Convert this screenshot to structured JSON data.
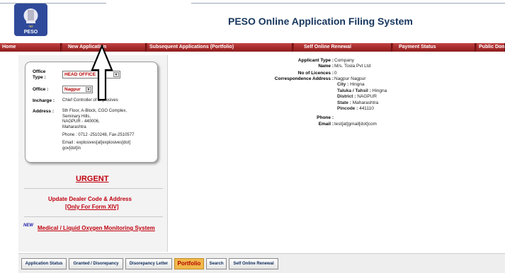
{
  "header": {
    "logo_text": "PESO",
    "title": "PESO Online Application Filing System"
  },
  "nav": {
    "items": [
      {
        "label": "Home"
      },
      {
        "label": "New Application"
      },
      {
        "label": "Subsequent Applications (Portfolio)"
      },
      {
        "label": "Self Online Renewal"
      },
      {
        "label": "Payment Status"
      },
      {
        "label": "Public Dom"
      }
    ]
  },
  "office_card": {
    "office_type_label": "Office Type :",
    "office_type_value": "HEAD OFFICE",
    "office_label": "Office :",
    "office_value": "Nagpur",
    "incharge_label": "Incharge :",
    "incharge_value": "Chief Controller of Explosives",
    "address_label": "Address :",
    "address_lines": [
      "5th Floor, A-Block, CGO Complex,",
      "Seminary Hills,",
      "NAGPUR - 440006,",
      "Maharashtra",
      "Phone : 0712 -2510248, Fax-2510577",
      "Email : explosives[at]explosives[dot]",
      "gov[dot]in"
    ]
  },
  "urgent": {
    "label": "URGENT",
    "dealer_line1": "Update Dealer Code & Address",
    "dealer_line2": "[Only For Form XIV]",
    "new_badge": "NEW",
    "oxygen_link": "Medical / Liquid Oxygen Monitoring System"
  },
  "applicant": {
    "type_label": "Applicant Type :",
    "type_value": "Company",
    "name_label": "Name :",
    "name_value": "M/s. Tosla Pvt Ltd",
    "licences_label": "No of Licences :",
    "licences_value": "0",
    "address_label": "Correspondence Address :",
    "address_value": "Nagpur Nagpur",
    "city_label": "City :",
    "city_value": "Hingna",
    "taluka_label": "Taluka / Tahsil :",
    "taluka_value": "Hingna",
    "district_label": "District :",
    "district_value": "NAGPUR",
    "state_label": "State :",
    "state_value": "Maharashtra",
    "pincode_label": "Pincode :",
    "pincode_value": "441110",
    "phone_label": "Phone :",
    "phone_value": "",
    "email_label": "Email :",
    "email_value": "test[at]gmail[dot]com"
  },
  "bottom_tabs": [
    {
      "label": "Application Status"
    },
    {
      "label": "Granted / Disorepancy"
    },
    {
      "label": "Disorepancy Letter"
    },
    {
      "label": "Portfolio"
    },
    {
      "label": "Search"
    },
    {
      "label": "Self Online Renewal"
    }
  ],
  "colors": {
    "nav_red": "#a62a2a",
    "title_blue": "#17375e",
    "urgent_red": "#c0000e",
    "active_tab": "#f0b84b"
  }
}
